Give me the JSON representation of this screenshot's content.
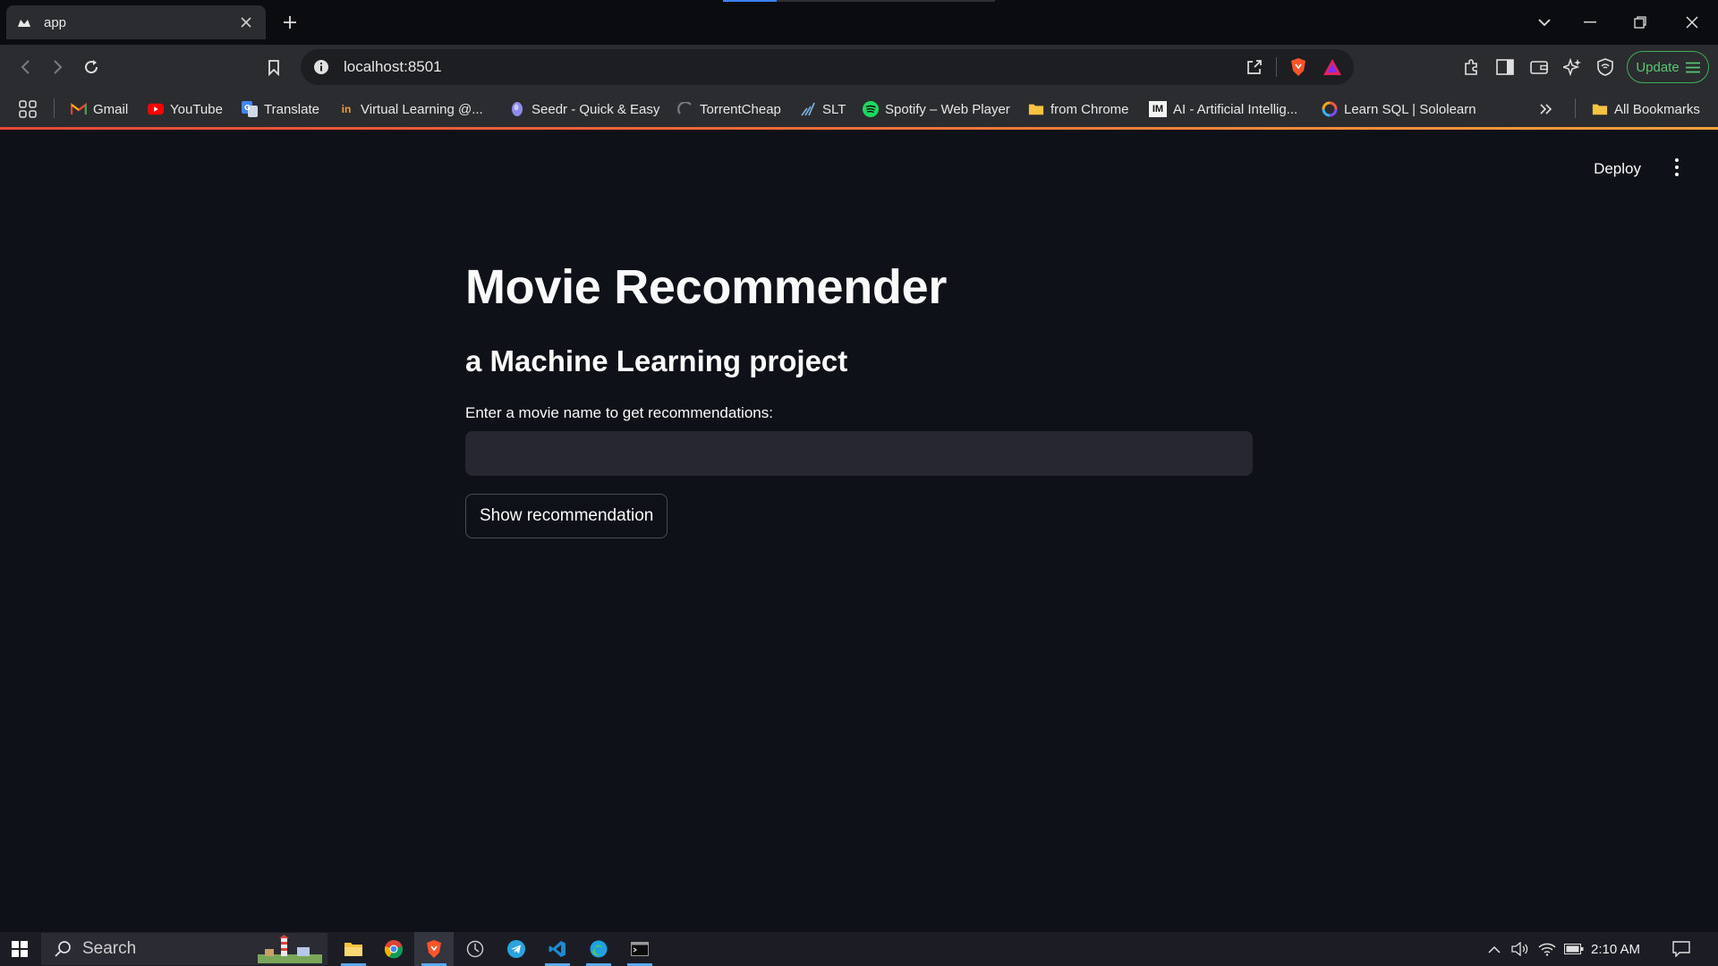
{
  "browser": {
    "tab_title": "app",
    "url": "localhost:8501",
    "update_label": "Update",
    "bookmarks": [
      {
        "label": "Gmail",
        "icon": "gmail-icon"
      },
      {
        "label": "YouTube",
        "icon": "youtube-icon"
      },
      {
        "label": "Translate",
        "icon": "translate-icon"
      },
      {
        "label": "Virtual Learning @...",
        "icon": "virtual-learning-icon"
      },
      {
        "label": "Seedr - Quick & Easy",
        "icon": "seedr-icon"
      },
      {
        "label": "TorrentCheap",
        "icon": "torrentcheap-icon"
      },
      {
        "label": "SLT",
        "icon": "slt-icon"
      },
      {
        "label": "Spotify – Web Player",
        "icon": "spotify-icon"
      },
      {
        "label": "from Chrome",
        "icon": "folder-icon"
      },
      {
        "label": "AI - Artificial Intellig...",
        "icon": "ai-site-icon"
      },
      {
        "label": "Learn SQL | Sololearn",
        "icon": "sololearn-icon"
      }
    ],
    "all_bookmarks_label": "All Bookmarks"
  },
  "app": {
    "deploy_label": "Deploy",
    "title": "Movie Recommender",
    "subtitle": "a Machine Learning project",
    "input_label": "Enter a movie name to get recommendations:",
    "input_value": "",
    "button_label": "Show recommendation"
  },
  "taskbar": {
    "search_placeholder": "Search",
    "clock": "2:10 AM"
  },
  "colors": {
    "app_background": "#0e1117",
    "input_background": "#262730",
    "update_green": "#3fae5a"
  }
}
